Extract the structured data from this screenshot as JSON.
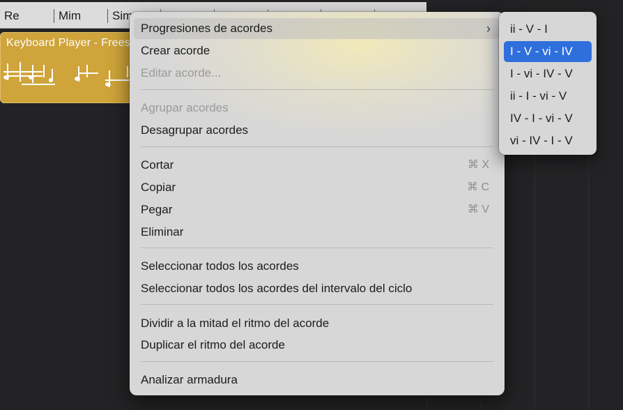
{
  "chord_track": {
    "cells": [
      "Re",
      "Mim",
      "Sim"
    ]
  },
  "region": {
    "title": "Keyboard Player - Freestyle",
    "color": "#cfa43a"
  },
  "menu": {
    "items": [
      {
        "label": "Progresiones de acordes",
        "has_submenu": true,
        "highlighted": true
      },
      {
        "label": "Crear acorde"
      },
      {
        "label": "Editar acorde...",
        "disabled": true
      },
      {
        "label": "Agrupar acordes",
        "disabled": true
      },
      {
        "label": "Desagrupar acordes"
      },
      {
        "label": "Cortar",
        "shortcut": "⌘ X"
      },
      {
        "label": "Copiar",
        "shortcut": "⌘ C"
      },
      {
        "label": "Pegar",
        "shortcut": "⌘ V"
      },
      {
        "label": "Eliminar"
      },
      {
        "label": "Seleccionar todos los acordes"
      },
      {
        "label": "Seleccionar todos los acordes del intervalo del ciclo"
      },
      {
        "label": "Dividir a la mitad el ritmo del acorde"
      },
      {
        "label": "Duplicar el ritmo del acorde"
      },
      {
        "label": "Analizar armadura"
      }
    ]
  },
  "submenu": {
    "items": [
      {
        "label": "ii - V - I"
      },
      {
        "label": "I - V - vi - IV",
        "selected": true
      },
      {
        "label": "I - vi - IV - V"
      },
      {
        "label": "ii - I - vi - V"
      },
      {
        "label": "IV - I - vi - V"
      },
      {
        "label": "vi - IV - I - V"
      }
    ],
    "selected_color": "#2f6fdc"
  },
  "icons": {
    "submenu_arrow": "chevron-right-icon"
  }
}
